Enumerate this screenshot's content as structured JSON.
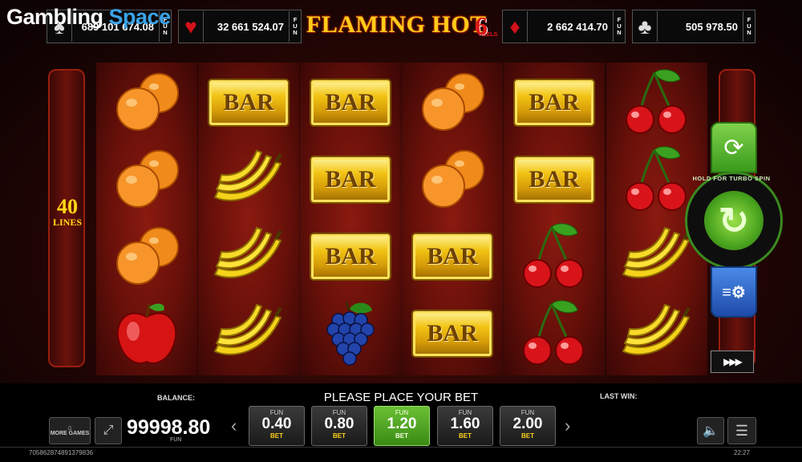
{
  "brand": {
    "part1": "Gambling",
    "part2": "Space"
  },
  "game": {
    "title": "FLAMING HOT",
    "six": "6",
    "reels": "REELS"
  },
  "jackpots": [
    {
      "suit": "♠",
      "value": "689 101 674.08",
      "fun": [
        "F",
        "U",
        "N"
      ]
    },
    {
      "suit": "♥",
      "value": "32 661 524.07",
      "fun": [
        "F",
        "U",
        "N"
      ]
    },
    {
      "suit": "♦",
      "value": "2 662 414.70",
      "fun": [
        "F",
        "U",
        "N"
      ]
    },
    {
      "suit": "♣",
      "value": "505 978.50",
      "fun": [
        "F",
        "U",
        "N"
      ]
    }
  ],
  "lines": {
    "count": "40",
    "label": "LINES"
  },
  "reels": [
    [
      "orange",
      "orange",
      "orange",
      "apple"
    ],
    [
      "bar",
      "banana",
      "banana",
      "banana"
    ],
    [
      "bar",
      "bar",
      "bar",
      "grapes"
    ],
    [
      "orange",
      "orange",
      "bar",
      "bar"
    ],
    [
      "bar",
      "bar",
      "cherry",
      "cherry"
    ],
    [
      "cherry",
      "cherry",
      "banana",
      "banana"
    ]
  ],
  "symbol_label": {
    "bar": "BAR"
  },
  "controls": {
    "spin_hint": "HOLD FOR TURBO SPIN",
    "autoplay": "▶▶▶"
  },
  "bottom": {
    "balance_label": "BALANCE:",
    "message": "PLEASE PLACE YOUR BET",
    "last_win_label": "LAST WIN:",
    "more_games": "MORE GAMES",
    "balance_value": "99998.80",
    "balance_currency": "FUN",
    "bets": [
      {
        "fun": "FUN",
        "value": "0.40",
        "bet": "BET",
        "selected": false
      },
      {
        "fun": "FUN",
        "value": "0.80",
        "bet": "BET",
        "selected": false
      },
      {
        "fun": "FUN",
        "value": "1.20",
        "bet": "BET",
        "selected": true
      },
      {
        "fun": "FUN",
        "value": "1.60",
        "bet": "BET",
        "selected": false
      },
      {
        "fun": "FUN",
        "value": "2.00",
        "bet": "BET",
        "selected": false
      }
    ],
    "session_id": "705862874891379836",
    "time": "22:27"
  }
}
